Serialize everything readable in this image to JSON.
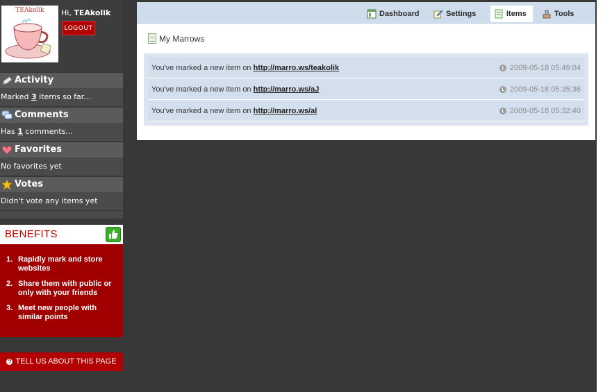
{
  "profile": {
    "avatar_caption": "TEAkolik",
    "greeting_prefix": "Hi, ",
    "username": "TEAkolik",
    "logout_label": "LOGOUT"
  },
  "stats": {
    "activity": {
      "title": "Activity",
      "text_before": "Marked ",
      "count": "3",
      "text_after": " items so far..."
    },
    "comments": {
      "title": "Comments",
      "text_before": "Has ",
      "count": "1",
      "text_after": " comments..."
    },
    "favorites": {
      "title": "Favorites",
      "text": "No favorites yet"
    },
    "votes": {
      "title": "Votes",
      "text": "Didn't vote any items yet"
    }
  },
  "benefits": {
    "title": "BENEFITS",
    "items": [
      {
        "num": "1.",
        "text": "Rapidly mark and store websites"
      },
      {
        "num": "2.",
        "text": "Share them with public or only with your friends"
      },
      {
        "num": "3.",
        "text": "Meet new people with similar points"
      }
    ]
  },
  "feedback_label": "TELL US ABOUT THIS PAGE",
  "nav": {
    "tabs": [
      {
        "label": "Dashboard",
        "icon": "dashboard-icon"
      },
      {
        "label": "Settings",
        "icon": "settings-icon"
      },
      {
        "label": "Items",
        "icon": "items-icon",
        "active": true
      },
      {
        "label": "Tools",
        "icon": "tools-icon"
      }
    ]
  },
  "main": {
    "section_title": "My Marrows",
    "items": [
      {
        "text": "You've marked a new item on ",
        "link": "http://marro.ws/teakolik",
        "timestamp": "2009-05-18 05:49:04"
      },
      {
        "text": "You've marked a new item on ",
        "link": "http://marro.ws/aJ",
        "timestamp": "2009-05-18 05:35:36"
      },
      {
        "text": "You've marked a new item on ",
        "link": "http://marro.ws/al",
        "timestamp": "2009-05-18 05:32:40"
      }
    ]
  },
  "colors": {
    "background": "#383838",
    "sidebar_header": "#5b5b5b",
    "brand_red": "#b30000",
    "nav_bar": "#cfdcec",
    "item_row": "#d4dfee"
  }
}
